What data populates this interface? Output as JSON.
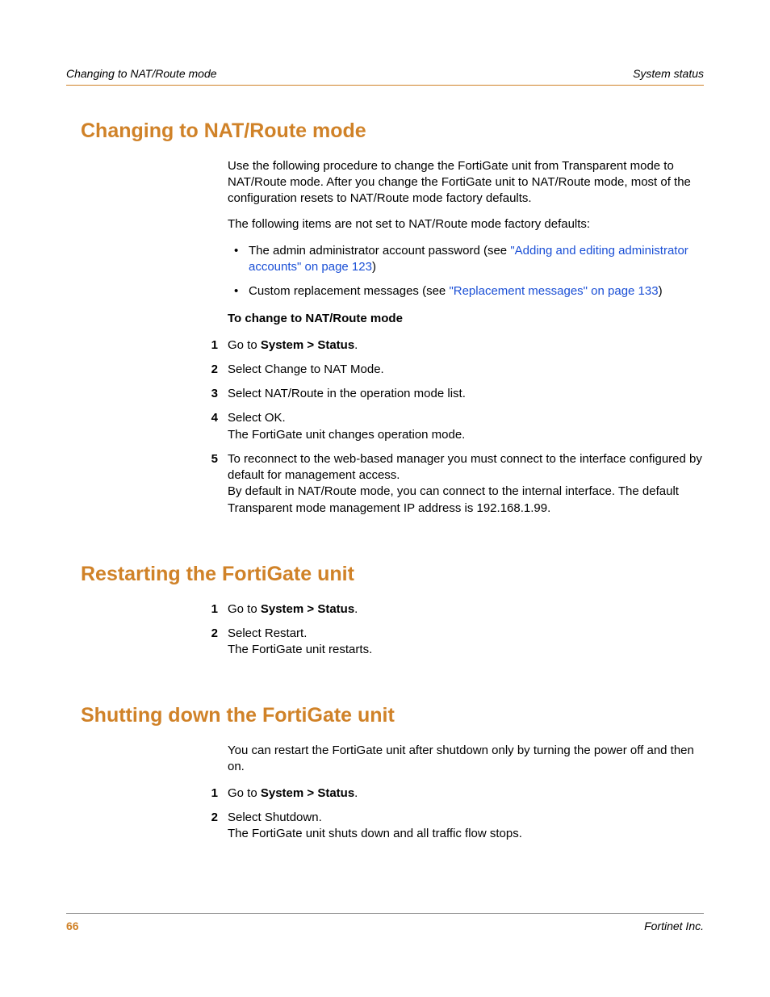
{
  "header": {
    "left": "Changing to NAT/Route mode",
    "right": "System status"
  },
  "sections": {
    "s1": {
      "title": "Changing to NAT/Route mode",
      "p1": "Use the following procedure to change the FortiGate unit from Transparent mode to NAT/Route mode. After you change the FortiGate unit to NAT/Route mode, most of the configuration resets to NAT/Route mode factory defaults.",
      "p2": "The following items are not set to NAT/Route mode factory defaults:",
      "b1_pre": "The admin administrator account password (see ",
      "b1_link": "\"Adding and editing administrator accounts\" on page 123",
      "b1_post": ")",
      "b2_pre": "Custom replacement messages (see ",
      "b2_link": "\"Replacement messages\" on page 133",
      "b2_post": ")",
      "subhead": "To change to NAT/Route mode",
      "step1_a": "Go to ",
      "step1_b": "System > Status",
      "step1_c": ".",
      "step2": "Select Change to NAT Mode.",
      "step3": "Select NAT/Route in the operation mode list.",
      "step4a": "Select OK.",
      "step4b": "The FortiGate unit changes operation mode.",
      "step5a": "To reconnect to the web-based manager you must connect to the interface configured by default for management access.",
      "step5b": "By default in NAT/Route mode, you can connect to the internal interface. The default Transparent mode management IP address is 192.168.1.99."
    },
    "s2": {
      "title": "Restarting the FortiGate unit",
      "step1_a": "Go to ",
      "step1_b": "System > Status",
      "step1_c": ".",
      "step2a": "Select Restart.",
      "step2b": "The FortiGate unit restarts."
    },
    "s3": {
      "title": "Shutting down the FortiGate unit",
      "p1": "You can restart the FortiGate unit after shutdown only by turning the power off and then on.",
      "step1_a": "Go to ",
      "step1_b": "System > Status",
      "step1_c": ".",
      "step2a": "Select Shutdown.",
      "step2b": "The FortiGate unit shuts down and all traffic flow stops."
    }
  },
  "footer": {
    "page": "66",
    "publisher": "Fortinet Inc."
  },
  "nums": {
    "n1": "1",
    "n2": "2",
    "n3": "3",
    "n4": "4",
    "n5": "5"
  }
}
